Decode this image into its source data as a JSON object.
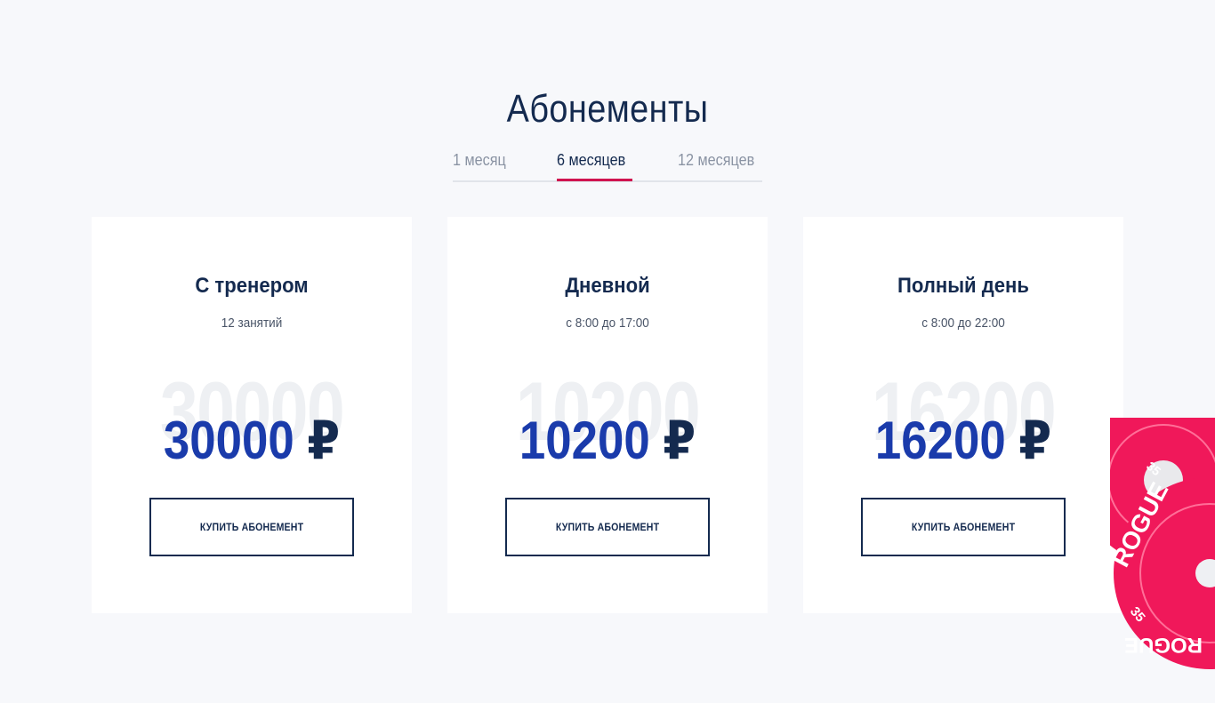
{
  "section": {
    "title": "Абонементы"
  },
  "tabs": [
    {
      "label": "1 месяц",
      "active": false
    },
    {
      "label": "6 месяцев",
      "active": true
    },
    {
      "label": "12 месяцев",
      "active": false
    }
  ],
  "cards": [
    {
      "title": "С тренером",
      "subtitle": "12 занятий",
      "price_bg": "30000",
      "price": "30000",
      "currency": "₽",
      "button": "КУПИТЬ АБОНЕМЕНТ"
    },
    {
      "title": "Дневной",
      "subtitle": "с 8:00 до 17:00",
      "price_bg": "10200",
      "price": "10200",
      "currency": "₽",
      "button": "КУПИТЬ АБОНЕМЕНТ"
    },
    {
      "title": "Полный день",
      "subtitle": "с 8:00 до 22:00",
      "price_bg": "16200",
      "price": "16200",
      "currency": "₽",
      "button": "КУПИТЬ АБОНЕМЕНТ"
    }
  ],
  "decor": {
    "plate_brand": "ROGUE",
    "plate_weight": "35",
    "plate_color": "#f0185a",
    "accent_color": "#d0134f",
    "price_color": "#1a3bab",
    "text_color": "#142a4f"
  }
}
